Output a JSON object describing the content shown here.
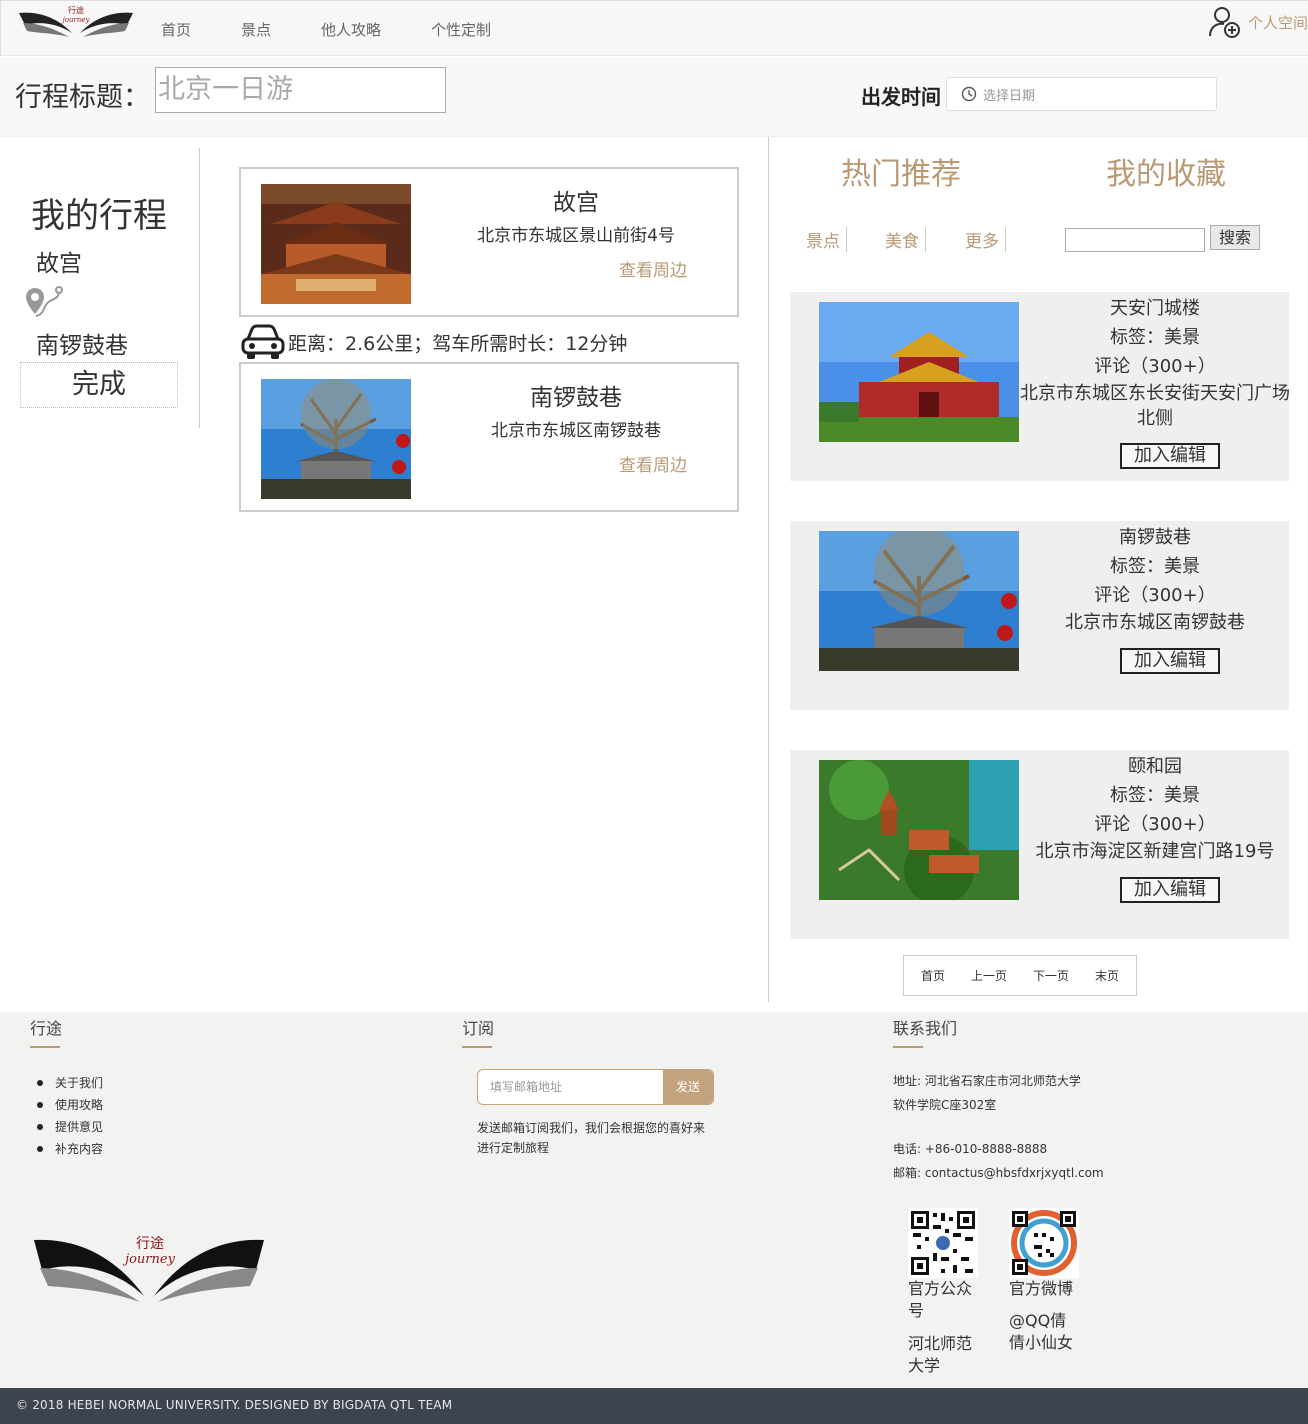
{
  "nav": {
    "logo_text": "行途",
    "logo_sub": "journey",
    "links": [
      "首页",
      "景点",
      "他人攻略",
      "个性定制"
    ],
    "user_label": "个人空间"
  },
  "titlebar": {
    "title_label": "行程标题：",
    "title_value": "北京一日游",
    "depart_label": "出发时间",
    "date_placeholder": "选择日期"
  },
  "itinerary": {
    "heading": "我的行程",
    "items": [
      "故宫",
      "南锣鼓巷"
    ],
    "done_label": "完成"
  },
  "cards": [
    {
      "name": "故宫",
      "address": "北京市东城区景山前街4号",
      "nearby": "查看周边"
    },
    {
      "name": "南锣鼓巷",
      "address": "北京市东城区南锣鼓巷",
      "nearby": "查看周边"
    }
  ],
  "distance": "距离：2.6公里；驾车所需时长：12分钟",
  "right": {
    "tabs": [
      "热门推荐",
      "我的收藏"
    ],
    "filters": [
      "景点",
      "美食",
      "更多"
    ],
    "search_label": "搜索",
    "recommendations": [
      {
        "name": "天安门城楼",
        "tag": "标签：美景",
        "comments": "评论（300+）",
        "address": "北京市东城区东长安街天安门广场北侧",
        "add_label": "加入编辑"
      },
      {
        "name": "南锣鼓巷",
        "tag": "标签：美景",
        "comments": "评论（300+）",
        "address": "北京市东城区南锣鼓巷",
        "add_label": "加入编辑"
      },
      {
        "name": "颐和园",
        "tag": "标签：美景",
        "comments": "评论（300+）",
        "address": "北京市海淀区新建宫门路19号",
        "add_label": "加入编辑"
      }
    ],
    "pager": [
      "首页",
      "上一页",
      "下一页",
      "末页"
    ]
  },
  "footer": {
    "col1_title": "行途",
    "col1_links": [
      "关于我们",
      "使用攻略",
      "提供意见",
      "补充内容"
    ],
    "col2_title": "订阅",
    "email_placeholder": "填写邮箱地址",
    "send_label": "发送",
    "subscribe_desc": "发送邮箱订阅我们，我们会根据您的喜好来进行定制旅程",
    "col3_title": "联系我们",
    "address_line1": "地址: 河北省石家庄市河北师范大学",
    "address_line2": "软件学院C座302室",
    "phone": "电话: +86-010-8888-8888",
    "email": "邮箱: contactus@hbsfdxrjxyqtl.com",
    "qr1_caption": "官方公众号",
    "qr1_sub": "河北师范大学",
    "qr2_caption": "官方微博",
    "qr2_sub": "@QQ倩倩小仙女",
    "logo_text": "行途",
    "logo_sub": "journey"
  },
  "copyright": "© 2018 HEBEI NORMAL UNIVERSITY. DESIGNED BY BIGDATA QTL TEAM",
  "colors": {
    "accent": "#b99a74",
    "footer_bg": "#f2f2f0",
    "bottom_bar": "#3d4450"
  }
}
